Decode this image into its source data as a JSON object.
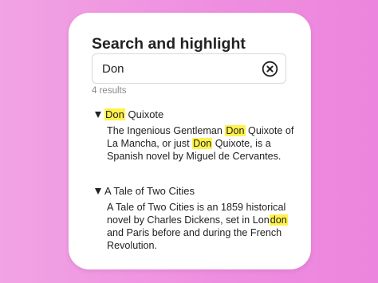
{
  "widget": {
    "title": "Search and highlight",
    "search": {
      "value": "Don",
      "clear_icon": "circled-x-icon"
    },
    "results_count": "4 results"
  },
  "results": [
    {
      "title_parts": [
        {
          "text": "Don",
          "highlight": true
        },
        {
          "text": " Quixote",
          "highlight": false
        }
      ],
      "expanded": true,
      "body_lines": [
        [
          {
            "text": "The Ingenious Gentleman ",
            "highlight": false
          },
          {
            "text": "Don",
            "highlight": true
          },
          {
            "text": " Quixote of",
            "highlight": false
          }
        ],
        [
          {
            "text": "La Mancha, or just ",
            "highlight": false
          },
          {
            "text": "Don",
            "highlight": true
          },
          {
            "text": " Quixote, is a",
            "highlight": false
          }
        ],
        [
          {
            "text": "Spanish novel by Miguel de Cervantes.",
            "highlight": false
          }
        ]
      ]
    },
    {
      "title_parts": [
        {
          "text": "A Tale of Two Cities",
          "highlight": false
        }
      ],
      "expanded": true,
      "body_lines": [
        [
          {
            "text": "A Tale of Two Cities is an 1859 historical",
            "highlight": false
          }
        ],
        [
          {
            "text": "novel by Charles Dickens, set in Lon",
            "highlight": false
          },
          {
            "text": "don",
            "highlight": true
          }
        ],
        [
          {
            "text": "and Paris before and during the French",
            "highlight": false
          }
        ],
        [
          {
            "text": "Revolution.",
            "highlight": false
          }
        ]
      ]
    }
  ],
  "colors": {
    "highlight": "#fff24a",
    "background_left": "#f1a3e4",
    "background_right": "#ec85dd",
    "card": "#ffffff"
  }
}
